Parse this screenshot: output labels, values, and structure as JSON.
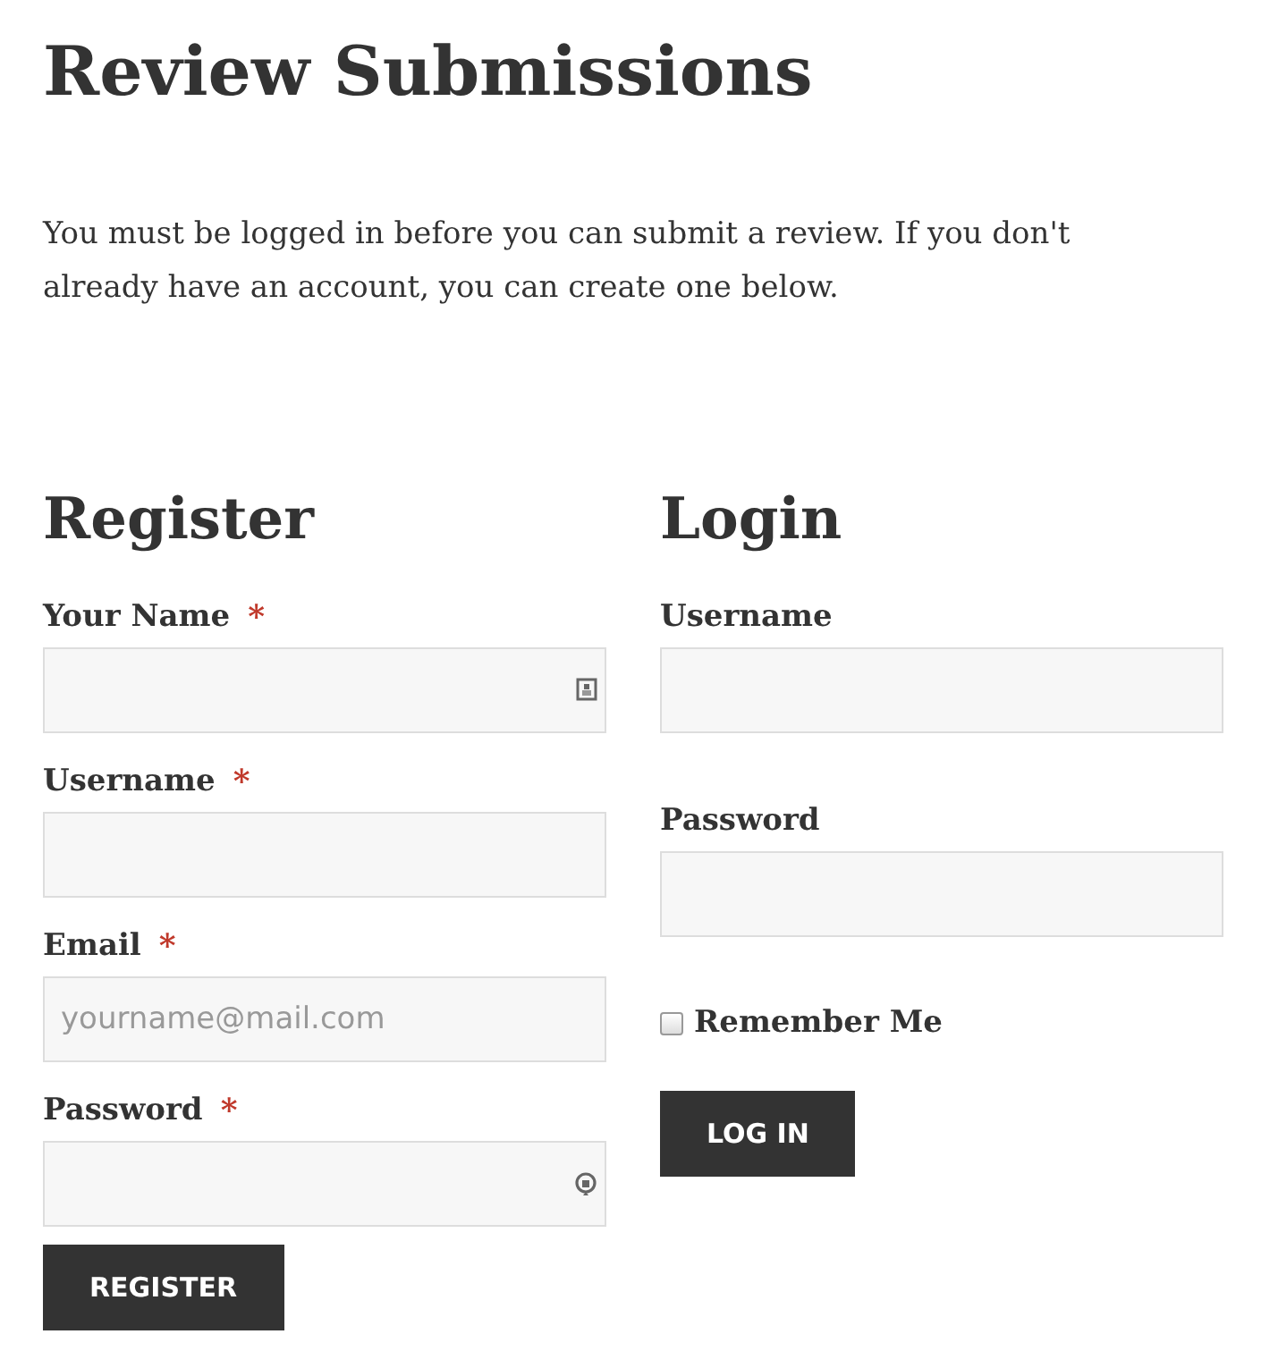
{
  "title": "Review Submissions",
  "intro": "You must be logged in before you can submit a review. If you don't already have an account, you can create one below.",
  "register": {
    "heading": "Register",
    "fields": [
      {
        "label": "Your Name",
        "required_mark": "*",
        "kind": "name"
      },
      {
        "label": "Username",
        "required_mark": "*"
      },
      {
        "label": "Email",
        "required_mark": "*",
        "placeholder": "yourname@mail.com"
      },
      {
        "label": "Password",
        "required_mark": "*",
        "kind": "password"
      }
    ],
    "button": "REGISTER"
  },
  "login": {
    "heading": "Login",
    "fields": [
      {
        "label": "Username"
      },
      {
        "label": "Password"
      }
    ],
    "remember": {
      "label": "Remember Me",
      "checked": false
    },
    "button": "LOG IN"
  }
}
